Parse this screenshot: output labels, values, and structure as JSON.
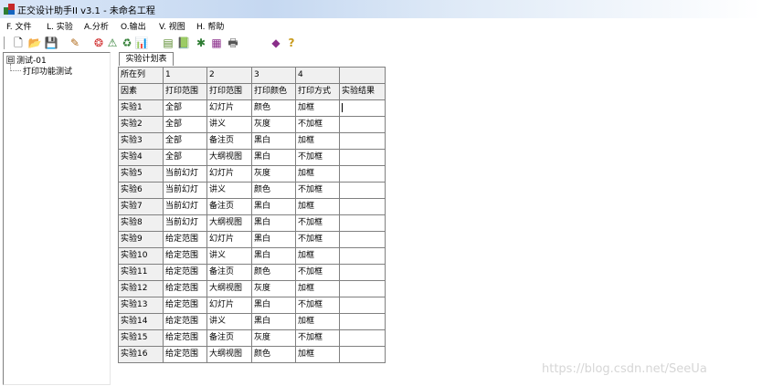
{
  "window": {
    "title": "正交设计助手II v3.1 - 未命名工程"
  },
  "menu": [
    {
      "label": "F. 文件"
    },
    {
      "label": "L. 实验"
    },
    {
      "label": "A.分析"
    },
    {
      "label": "O.输出"
    },
    {
      "label": "V. 视图"
    },
    {
      "label": "H. 帮助"
    }
  ],
  "toolbar": {
    "buttons": [
      {
        "icon": "new-file-icon",
        "glyph": "🗋"
      },
      {
        "icon": "open-folder-icon",
        "glyph": "📂"
      },
      {
        "icon": "save-disk-icon",
        "glyph": "💾"
      },
      {
        "icon": "wand-icon",
        "glyph": "✎"
      },
      {
        "icon": "color-wheel-icon",
        "glyph": "❂"
      },
      {
        "icon": "warning-triangle-icon",
        "glyph": "⚠"
      },
      {
        "icon": "cycle-icon",
        "glyph": "♻"
      },
      {
        "icon": "chart-icon",
        "glyph": "📊"
      },
      {
        "icon": "table-icon",
        "glyph": "▤"
      },
      {
        "icon": "book-icon",
        "glyph": "📗"
      },
      {
        "icon": "puzzle-icon",
        "glyph": "✱"
      },
      {
        "icon": "grid-icon",
        "glyph": "▦"
      },
      {
        "icon": "print-icon",
        "glyph": "🖶"
      },
      {
        "icon": "diamond-icon",
        "glyph": "◆"
      },
      {
        "icon": "help-icon",
        "glyph": "?"
      }
    ]
  },
  "tree": {
    "root": {
      "label": "测试-01",
      "toggle": "⊟"
    },
    "child": {
      "label": "打印功能测试"
    }
  },
  "tab": {
    "label": "实验计划表"
  },
  "table": {
    "header": [
      "所在列",
      "1",
      "2",
      "3",
      "4",
      ""
    ],
    "factors": [
      "因素",
      "打印范围",
      "打印范围",
      "打印颜色",
      "打印方式",
      "实验结果"
    ],
    "rows": [
      [
        "实验1",
        "全部",
        "幻灯片",
        "颜色",
        "加框"
      ],
      [
        "实验2",
        "全部",
        "讲义",
        "灰度",
        "不加框"
      ],
      [
        "实验3",
        "全部",
        "备注页",
        "黑白",
        "加框"
      ],
      [
        "实验4",
        "全部",
        "大纲视图",
        "黑白",
        "不加框"
      ],
      [
        "实验5",
        "当前幻灯",
        "幻灯片",
        "灰度",
        "加框"
      ],
      [
        "实验6",
        "当前幻灯",
        "讲义",
        "颜色",
        "不加框"
      ],
      [
        "实验7",
        "当前幻灯",
        "备注页",
        "黑白",
        "加框"
      ],
      [
        "实验8",
        "当前幻灯",
        "大纲视图",
        "黑白",
        "不加框"
      ],
      [
        "实验9",
        "给定范围",
        "幻灯片",
        "黑白",
        "不加框"
      ],
      [
        "实验10",
        "给定范围",
        "讲义",
        "黑白",
        "加框"
      ],
      [
        "实验11",
        "给定范围",
        "备注页",
        "颜色",
        "不加框"
      ],
      [
        "实验12",
        "给定范围",
        "大纲视图",
        "灰度",
        "加框"
      ],
      [
        "实验13",
        "给定范围",
        "幻灯片",
        "黑白",
        "不加框"
      ],
      [
        "实验14",
        "给定范围",
        "讲义",
        "黑白",
        "加框"
      ],
      [
        "实验15",
        "给定范围",
        "备注页",
        "灰度",
        "不加框"
      ],
      [
        "实验16",
        "给定范围",
        "大纲视图",
        "颜色",
        "加框"
      ]
    ]
  },
  "watermark": {
    "text": "https://blog.csdn.net/SeeUa"
  }
}
